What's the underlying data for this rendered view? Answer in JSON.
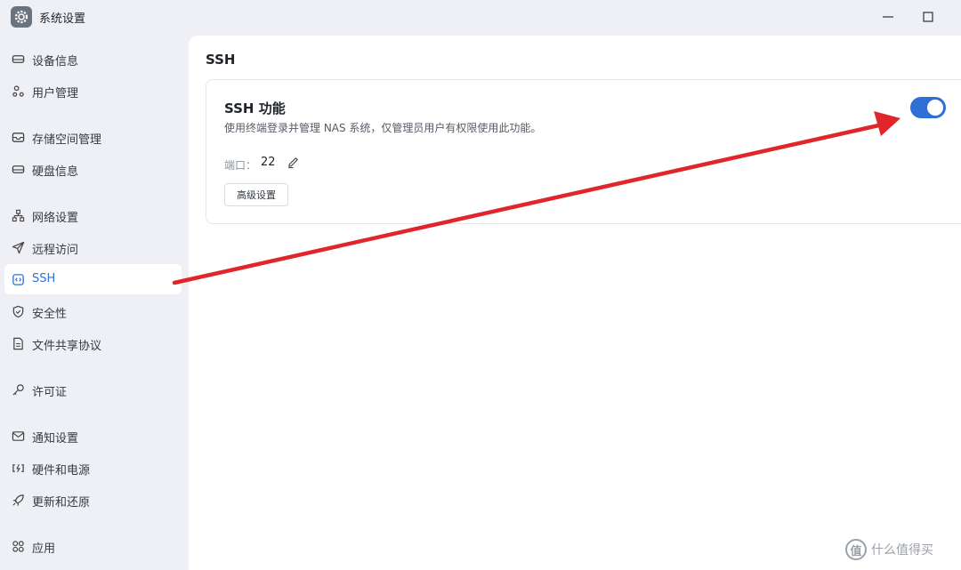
{
  "window": {
    "title": "系统设置",
    "icon": "gear-icon"
  },
  "sidebar": {
    "items": [
      {
        "label": "设备信息",
        "icon": "device-icon"
      },
      {
        "label": "用户管理",
        "icon": "users-icon"
      },
      {
        "label": "存储空间管理",
        "icon": "storage-icon"
      },
      {
        "label": "硬盘信息",
        "icon": "disk-icon"
      },
      {
        "label": "网络设置",
        "icon": "network-icon"
      },
      {
        "label": "远程访问",
        "icon": "send-icon"
      },
      {
        "label": "SSH",
        "icon": "terminal-icon",
        "active": true
      },
      {
        "label": "安全性",
        "icon": "shield-icon"
      },
      {
        "label": "文件共享协议",
        "icon": "file-icon"
      },
      {
        "label": "许可证",
        "icon": "key-icon"
      },
      {
        "label": "通知设置",
        "icon": "mail-icon"
      },
      {
        "label": "硬件和电源",
        "icon": "power-icon"
      },
      {
        "label": "更新和还原",
        "icon": "rocket-icon"
      },
      {
        "label": "应用",
        "icon": "apps-icon"
      }
    ]
  },
  "main": {
    "title": "SSH",
    "card": {
      "title": "SSH 功能",
      "description": "使用终端登录并管理 NAS 系统，仅管理员用户有权限使用此功能。",
      "port_label": "端口：",
      "port_value": "22",
      "advanced_button": "高级设置",
      "toggle_on": true
    }
  },
  "watermark": {
    "text": "什么值得买",
    "logo": "值"
  },
  "colors": {
    "accent": "#2f6fd6",
    "arrow": "#e0262b",
    "sidebar_bg": "#eef0f5"
  }
}
